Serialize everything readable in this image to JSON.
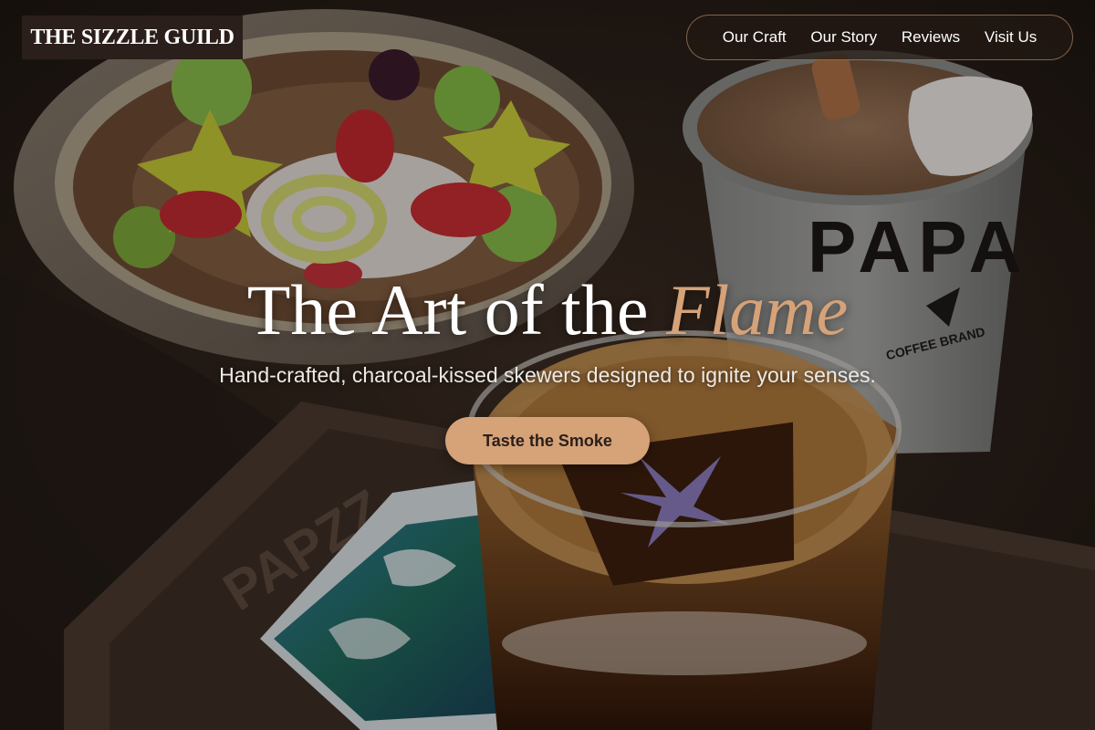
{
  "brand": {
    "name": "THE SIZZLE GUILD"
  },
  "nav": {
    "items": [
      {
        "label": "Our Craft"
      },
      {
        "label": "Our Story"
      },
      {
        "label": "Reviews"
      },
      {
        "label": "Visit Us"
      }
    ]
  },
  "hero": {
    "title_main": "The Art of the ",
    "title_accent": "Flame",
    "subtitle": "Hand-crafted, charcoal-kissed skewers designed to ignite your senses.",
    "cta_label": "Taste the Smoke",
    "photo_cup_print": "PAPA",
    "photo_cup_sub": "COFFEE BRAND",
    "photo_tray_print": "PAPZZ"
  },
  "colors": {
    "accent": "#d6a278",
    "brand_bg": "#2a1f1a",
    "nav_bg": "#221914",
    "text_light": "#ffffff"
  }
}
